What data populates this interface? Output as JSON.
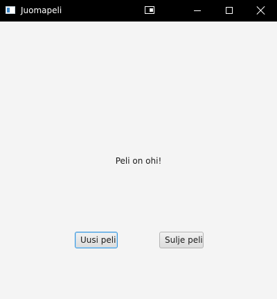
{
  "window": {
    "title": "Juomapeli",
    "controls": {
      "minimize": "minimize",
      "maximize": "maximize",
      "close": "close"
    }
  },
  "main": {
    "message": "Peli on ohi!",
    "new_game_label": "Uusi peli",
    "quit_game_label": "Sulje peli"
  },
  "colors": {
    "titlebar": "#000000",
    "background": "#f4f4f4",
    "focus_border": "#3a94d8"
  }
}
